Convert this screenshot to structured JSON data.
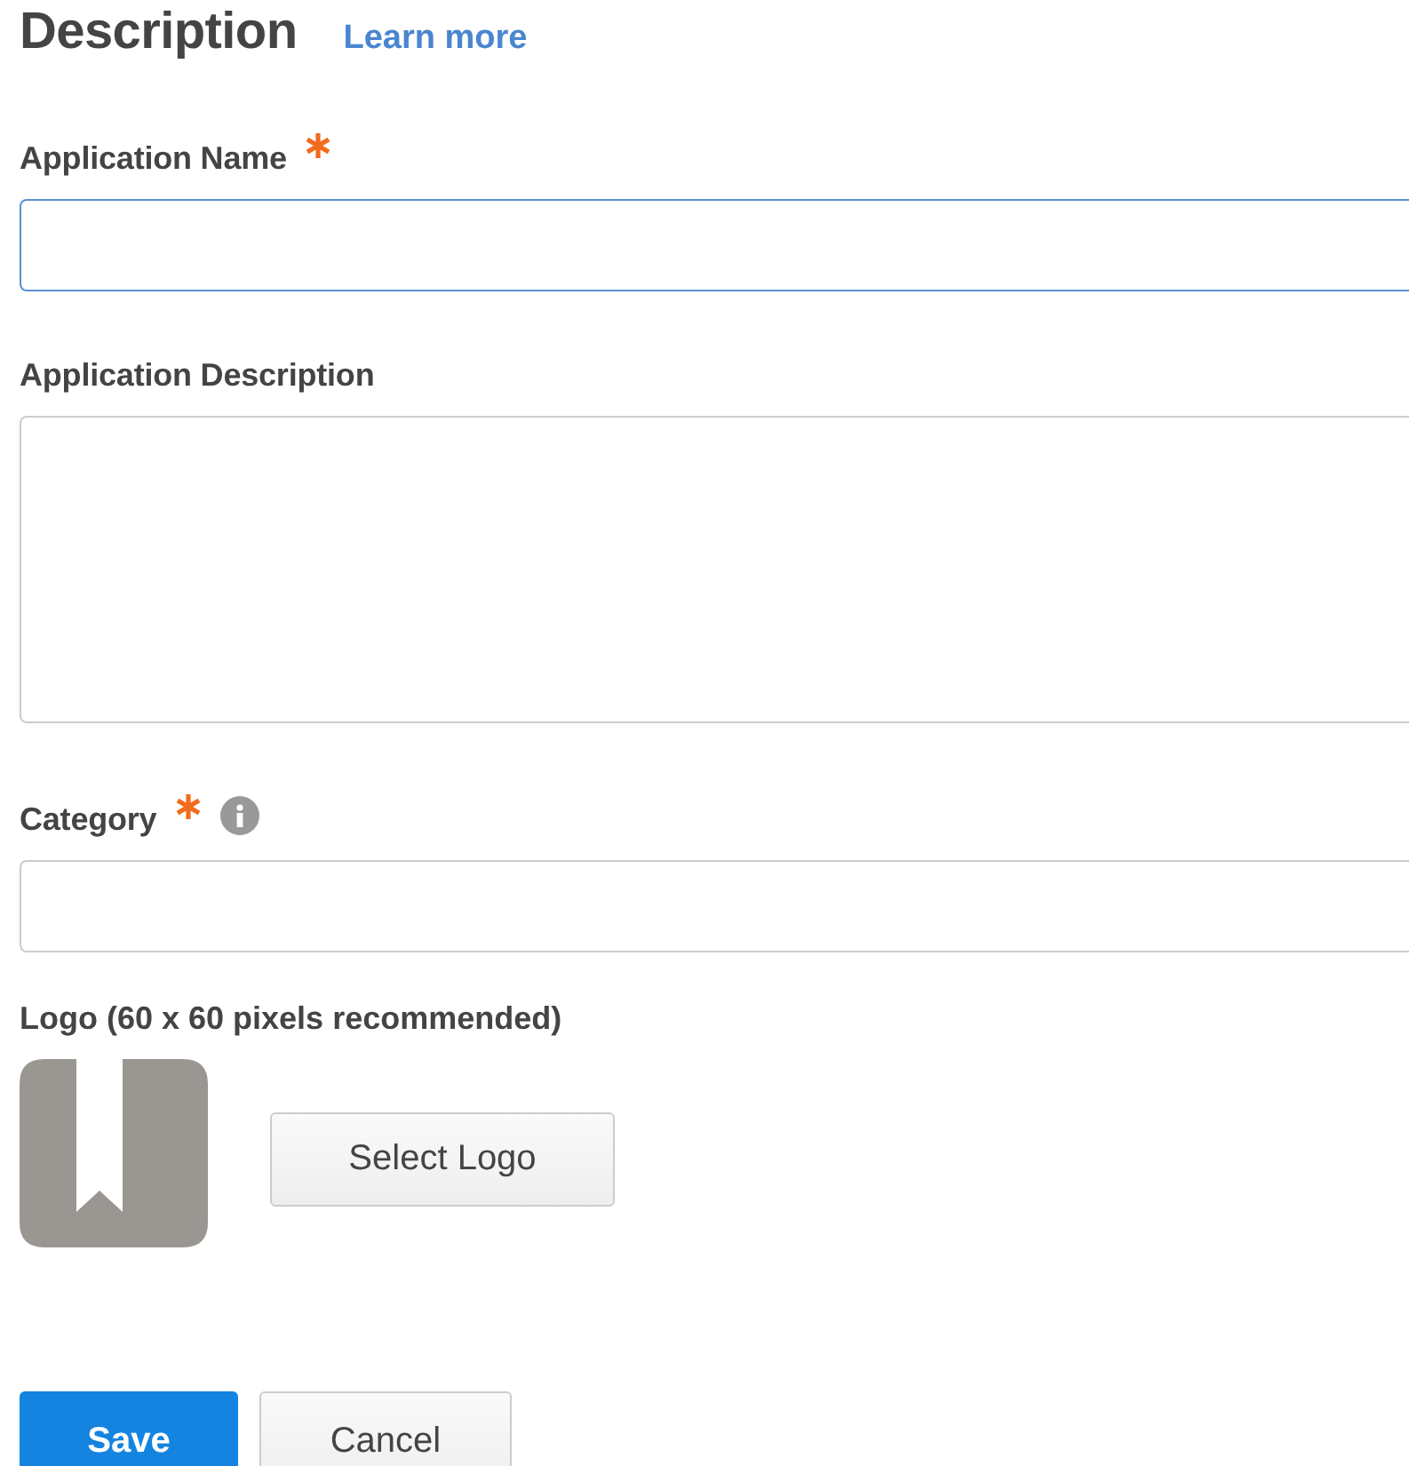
{
  "header": {
    "title": "Description",
    "link": "Learn more"
  },
  "fields": [
    {
      "kind": "input",
      "label": "Application Name",
      "required": true,
      "info": false,
      "focused": true
    },
    {
      "kind": "textarea",
      "label": "Application Description",
      "required": false,
      "info": false,
      "focused": false
    },
    {
      "kind": "input",
      "label": "Category",
      "required": true,
      "info": true,
      "focused": false
    }
  ],
  "logo": {
    "label": "Logo (60 x 60 pixels recommended)",
    "button": "Select Logo"
  },
  "buttons": [
    {
      "label": "Save",
      "kind": "primary"
    },
    {
      "label": "Cancel",
      "kind": "secondary"
    }
  ]
}
